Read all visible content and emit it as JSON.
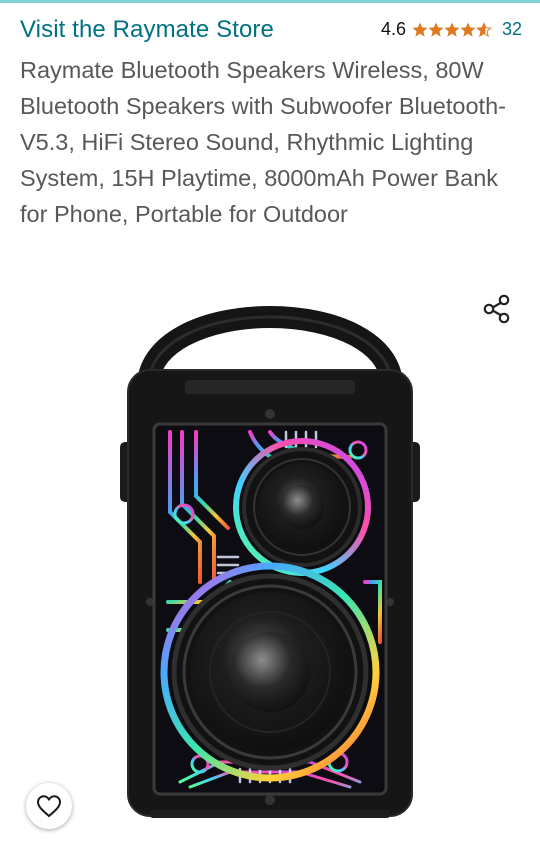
{
  "store": {
    "link_text": "Visit the Raymate Store"
  },
  "rating": {
    "value": "4.6",
    "stars": 4.6,
    "count": "32"
  },
  "product": {
    "title": "Raymate Bluetooth Speakers Wireless, 80W Bluetooth Speakers with Subwoofer Bluetooth-V5.3, HiFi Stereo Sound, Rhythmic Lighting System, 15H Playtime, 8000mAh Power Bank for Phone, Portable for Outdoor"
  },
  "icons": {
    "share": "share-icon",
    "favorite": "heart-icon",
    "star": "star-icon"
  },
  "colors": {
    "link": "#007185",
    "star": "#de7921",
    "title": "#565959",
    "accent_bar": "#7fd3d6"
  }
}
